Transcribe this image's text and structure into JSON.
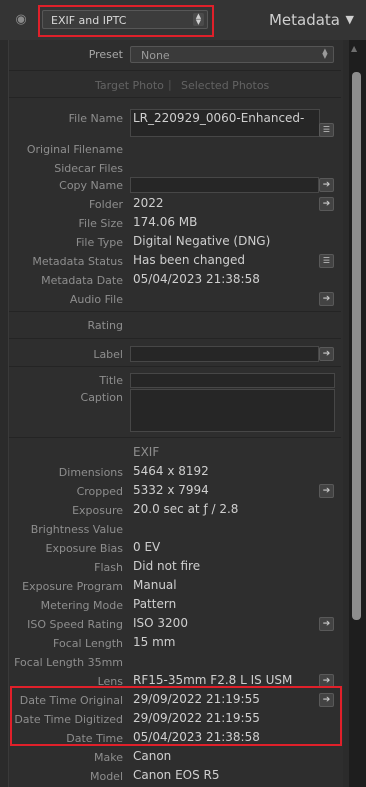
{
  "header": {
    "preset_dropdown": "EXIF and IPTC",
    "panel_title": "Metadata"
  },
  "preset": {
    "label": "Preset",
    "value": "None"
  },
  "target": {
    "target_photo": "Target Photo",
    "separator": "|",
    "selected_photos": "Selected Photos"
  },
  "fields": {
    "file_name": {
      "label": "File Name",
      "value": "LR_220929_0060-Enhanced-"
    },
    "original_filename": {
      "label": "Original Filename"
    },
    "sidecar_files": {
      "label": "Sidecar Files"
    },
    "copy_name": {
      "label": "Copy Name"
    },
    "folder": {
      "label": "Folder",
      "value": "2022"
    },
    "file_size": {
      "label": "File Size",
      "value": "174.06 MB"
    },
    "file_type": {
      "label": "File Type",
      "value": "Digital Negative (DNG)"
    },
    "metadata_status": {
      "label": "Metadata Status",
      "value": "Has been changed"
    },
    "metadata_date": {
      "label": "Metadata Date",
      "value": "05/04/2023 21:38:58"
    },
    "audio_file": {
      "label": "Audio File"
    },
    "rating": {
      "label": "Rating"
    },
    "label": {
      "label": "Label"
    },
    "title": {
      "label": "Title"
    },
    "caption": {
      "label": "Caption"
    }
  },
  "exif": {
    "heading": "EXIF",
    "dimensions": {
      "label": "Dimensions",
      "value": "5464 x 8192"
    },
    "cropped": {
      "label": "Cropped",
      "value": "5332 x 7994"
    },
    "exposure": {
      "label": "Exposure",
      "value": "20.0 sec at ƒ / 2.8"
    },
    "brightness_value": {
      "label": "Brightness Value"
    },
    "exposure_bias": {
      "label": "Exposure Bias",
      "value": "0 EV"
    },
    "flash": {
      "label": "Flash",
      "value": "Did not fire"
    },
    "exposure_program": {
      "label": "Exposure Program",
      "value": "Manual"
    },
    "metering_mode": {
      "label": "Metering Mode",
      "value": "Pattern"
    },
    "iso": {
      "label": "ISO Speed Rating",
      "value": "ISO 3200"
    },
    "focal_length": {
      "label": "Focal Length",
      "value": "15 mm"
    },
    "focal_length_35": {
      "label": "Focal Length 35mm"
    },
    "lens": {
      "label": "Lens",
      "value": "RF15-35mm F2.8 L IS USM"
    },
    "date_time_original": {
      "label": "Date Time Original",
      "value": "29/09/2022 21:19:55"
    },
    "date_time_digitized": {
      "label": "Date Time Digitized",
      "value": "29/09/2022 21:19:55"
    },
    "date_time": {
      "label": "Date Time",
      "value": "05/04/2023 21:38:58"
    },
    "make": {
      "label": "Make",
      "value": "Canon"
    },
    "model": {
      "label": "Model",
      "value": "Canon EOS R5"
    }
  },
  "icons": {
    "eye": "eye-icon",
    "collapse": "triangle-down-icon",
    "arrow": "arrow-right-icon",
    "list": "list-icon"
  },
  "colors": {
    "highlight": "#e0202a",
    "background": "#2b2b2b"
  }
}
